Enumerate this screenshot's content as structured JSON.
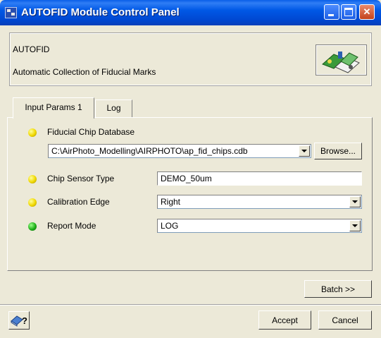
{
  "window": {
    "title": "AUTOFID Module Control Panel"
  },
  "titlebar_buttons": {
    "minimize": "minimize",
    "maximize": "maximize",
    "close": "close"
  },
  "header": {
    "module_name": "AUTOFID",
    "description": "Automatic Collection of Fiducial Marks"
  },
  "tabs": [
    {
      "label": "Input Params 1",
      "active": true
    },
    {
      "label": "Log",
      "active": false
    }
  ],
  "params": {
    "fiducial_db": {
      "label": "Fiducial Chip Database",
      "value": "C:\\AirPhoto_Modelling\\AIRPHOTO\\ap_fid_chips.cdb",
      "status": "yellow",
      "browse_label": "Browse..."
    },
    "chip_sensor_type": {
      "label": "Chip Sensor Type",
      "value": "DEMO_50um",
      "status": "yellow"
    },
    "calibration_edge": {
      "label": "Calibration Edge",
      "value": "Right",
      "status": "yellow"
    },
    "report_mode": {
      "label": "Report Mode",
      "value": "LOG",
      "status": "green"
    }
  },
  "buttons": {
    "batch": "Batch >>",
    "accept": "Accept",
    "cancel": "Cancel"
  },
  "colors": {
    "titlebar": "#0058e6",
    "dialog_bg": "#ece9d8",
    "led_yellow": "#f0d800",
    "led_green": "#1fb01a"
  }
}
